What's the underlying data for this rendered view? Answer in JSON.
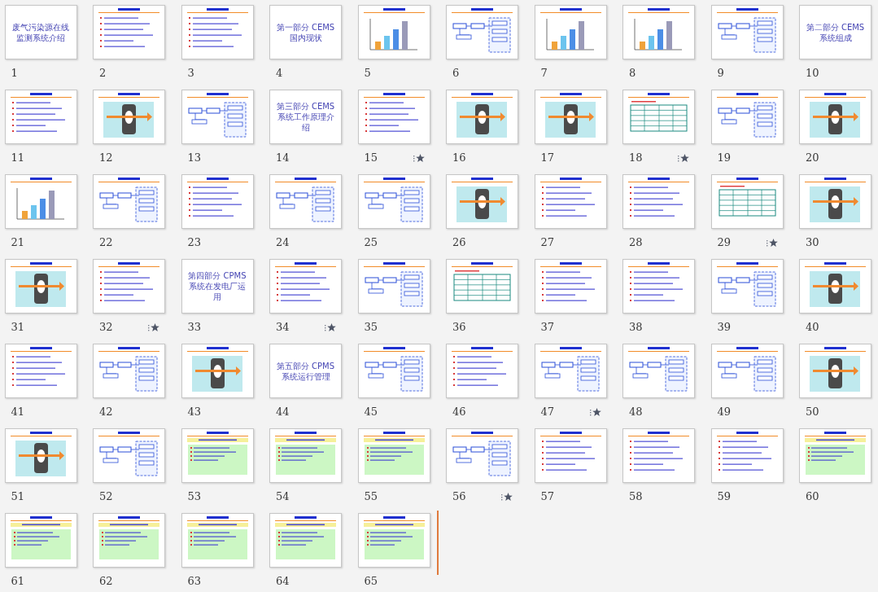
{
  "slides": [
    {
      "number": "1",
      "kind": "title",
      "title": "废气污染源在线监测系统介绍",
      "selected": false,
      "animated": false,
      "insert_after": false
    },
    {
      "number": "2",
      "kind": "text",
      "selected": false,
      "animated": false,
      "insert_after": false
    },
    {
      "number": "3",
      "kind": "text",
      "selected": false,
      "animated": false,
      "insert_after": false
    },
    {
      "number": "4",
      "kind": "title",
      "title": "第一部分 CEMS国内现状",
      "selected": false,
      "animated": false,
      "insert_after": false
    },
    {
      "number": "5",
      "kind": "chart",
      "selected": false,
      "animated": false,
      "insert_after": false
    },
    {
      "number": "6",
      "kind": "diagram",
      "selected": false,
      "animated": false,
      "insert_after": false
    },
    {
      "number": "7",
      "kind": "chart",
      "selected": false,
      "animated": false,
      "insert_after": false
    },
    {
      "number": "8",
      "kind": "chart",
      "selected": false,
      "animated": false,
      "insert_after": false
    },
    {
      "number": "9",
      "kind": "diagram",
      "selected": false,
      "animated": false,
      "insert_after": false
    },
    {
      "number": "10",
      "kind": "title",
      "title": "第二部分 CEMS系统组成",
      "selected": false,
      "animated": false,
      "insert_after": false
    },
    {
      "number": "11",
      "kind": "text",
      "selected": false,
      "animated": false,
      "insert_after": false
    },
    {
      "number": "12",
      "kind": "picture",
      "selected": false,
      "animated": false,
      "insert_after": false
    },
    {
      "number": "13",
      "kind": "diagram",
      "selected": false,
      "animated": false,
      "insert_after": false
    },
    {
      "number": "14",
      "kind": "title",
      "title": "第三部分 CEMS系统工作原理介绍",
      "selected": false,
      "animated": false,
      "insert_after": false
    },
    {
      "number": "15",
      "kind": "text",
      "selected": false,
      "animated": true,
      "insert_after": false
    },
    {
      "number": "16",
      "kind": "picture",
      "selected": false,
      "animated": false,
      "insert_after": false
    },
    {
      "number": "17",
      "kind": "picture",
      "selected": false,
      "animated": false,
      "insert_after": false
    },
    {
      "number": "18",
      "kind": "table",
      "selected": false,
      "animated": true,
      "insert_after": false
    },
    {
      "number": "19",
      "kind": "diagram",
      "selected": false,
      "animated": false,
      "insert_after": false
    },
    {
      "number": "20",
      "kind": "picture",
      "selected": false,
      "animated": false,
      "insert_after": false
    },
    {
      "number": "21",
      "kind": "chart",
      "selected": false,
      "animated": false,
      "insert_after": false
    },
    {
      "number": "22",
      "kind": "diagram",
      "selected": false,
      "animated": false,
      "insert_after": false
    },
    {
      "number": "23",
      "kind": "text",
      "selected": false,
      "animated": false,
      "insert_after": false
    },
    {
      "number": "24",
      "kind": "diagram",
      "selected": false,
      "animated": false,
      "insert_after": false
    },
    {
      "number": "25",
      "kind": "diagram",
      "selected": false,
      "animated": false,
      "insert_after": false
    },
    {
      "number": "26",
      "kind": "picture",
      "selected": false,
      "animated": false,
      "insert_after": false
    },
    {
      "number": "27",
      "kind": "text",
      "selected": false,
      "animated": false,
      "insert_after": false
    },
    {
      "number": "28",
      "kind": "text",
      "selected": false,
      "animated": false,
      "insert_after": false
    },
    {
      "number": "29",
      "kind": "table",
      "selected": false,
      "animated": true,
      "insert_after": false
    },
    {
      "number": "30",
      "kind": "picture",
      "selected": false,
      "animated": false,
      "insert_after": false
    },
    {
      "number": "31",
      "kind": "picture",
      "selected": false,
      "animated": false,
      "insert_after": false
    },
    {
      "number": "32",
      "kind": "text",
      "selected": false,
      "animated": true,
      "insert_after": false
    },
    {
      "number": "33",
      "kind": "title",
      "title": "第四部分 CPMS系统在发电厂运用",
      "selected": false,
      "animated": false,
      "insert_after": false
    },
    {
      "number": "34",
      "kind": "text",
      "selected": false,
      "animated": true,
      "insert_after": false
    },
    {
      "number": "35",
      "kind": "diagram",
      "selected": false,
      "animated": false,
      "insert_after": false
    },
    {
      "number": "36",
      "kind": "table",
      "selected": false,
      "animated": false,
      "insert_after": false
    },
    {
      "number": "37",
      "kind": "text",
      "selected": false,
      "animated": false,
      "insert_after": false
    },
    {
      "number": "38",
      "kind": "text",
      "selected": false,
      "animated": false,
      "insert_after": false
    },
    {
      "number": "39",
      "kind": "diagram",
      "selected": false,
      "animated": false,
      "insert_after": false
    },
    {
      "number": "40",
      "kind": "picture",
      "selected": false,
      "animated": false,
      "insert_after": false
    },
    {
      "number": "41",
      "kind": "text",
      "selected": false,
      "animated": false,
      "insert_after": false
    },
    {
      "number": "42",
      "kind": "diagram",
      "selected": false,
      "animated": false,
      "insert_after": false
    },
    {
      "number": "43",
      "kind": "picture",
      "selected": false,
      "animated": false,
      "insert_after": false
    },
    {
      "number": "44",
      "kind": "title",
      "title": "第五部分 CPMS系统运行管理",
      "selected": false,
      "animated": false,
      "insert_after": false
    },
    {
      "number": "45",
      "kind": "diagram",
      "selected": false,
      "animated": false,
      "insert_after": false
    },
    {
      "number": "46",
      "kind": "text",
      "selected": false,
      "animated": false,
      "insert_after": false
    },
    {
      "number": "47",
      "kind": "diagram",
      "selected": false,
      "animated": true,
      "insert_after": false
    },
    {
      "number": "48",
      "kind": "diagram",
      "selected": false,
      "animated": false,
      "insert_after": false
    },
    {
      "number": "49",
      "kind": "diagram",
      "selected": false,
      "animated": false,
      "insert_after": false
    },
    {
      "number": "50",
      "kind": "picture",
      "selected": false,
      "animated": false,
      "insert_after": false
    },
    {
      "number": "51",
      "kind": "picture",
      "selected": false,
      "animated": false,
      "insert_after": false
    },
    {
      "number": "52",
      "kind": "diagram",
      "selected": false,
      "animated": false,
      "insert_after": false
    },
    {
      "number": "53",
      "kind": "panel",
      "selected": false,
      "animated": false,
      "insert_after": false
    },
    {
      "number": "54",
      "kind": "panel",
      "selected": false,
      "animated": false,
      "insert_after": false
    },
    {
      "number": "55",
      "kind": "panel",
      "selected": false,
      "animated": false,
      "insert_after": false
    },
    {
      "number": "56",
      "kind": "diagram",
      "selected": false,
      "animated": true,
      "insert_after": false
    },
    {
      "number": "57",
      "kind": "text",
      "selected": false,
      "animated": false,
      "insert_after": false
    },
    {
      "number": "58",
      "kind": "text",
      "selected": false,
      "animated": false,
      "insert_after": false
    },
    {
      "number": "59",
      "kind": "text",
      "selected": false,
      "animated": false,
      "insert_after": false
    },
    {
      "number": "60",
      "kind": "panel",
      "selected": false,
      "animated": false,
      "insert_after": false
    },
    {
      "number": "61",
      "kind": "panel",
      "selected": false,
      "animated": false,
      "insert_after": false
    },
    {
      "number": "62",
      "kind": "panel",
      "selected": false,
      "animated": false,
      "insert_after": false
    },
    {
      "number": "63",
      "kind": "panel",
      "selected": false,
      "animated": false,
      "insert_after": false
    },
    {
      "number": "64",
      "kind": "panel",
      "selected": false,
      "animated": false,
      "insert_after": false
    },
    {
      "number": "65",
      "kind": "panel",
      "selected": false,
      "animated": false,
      "insert_after": true
    }
  ]
}
